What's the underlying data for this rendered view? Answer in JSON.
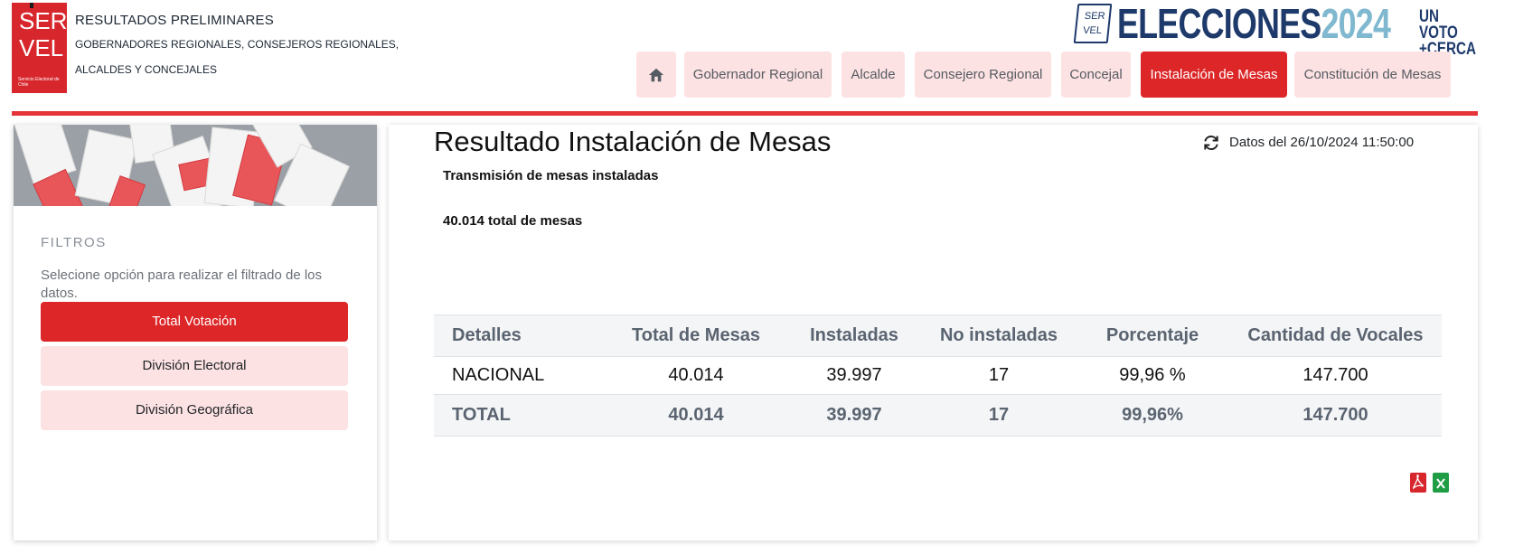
{
  "header": {
    "logo": {
      "line1": "SER",
      "line2": "VEL",
      "tagline": "Servicio Electoral de Chile"
    },
    "title": "RESULTADOS PRELIMINARES",
    "subtitle_line1": "GOBERNADORES REGIONALES, CONSEJEROS REGIONALES,",
    "subtitle_line2": "ALCALDES Y CONCEJALES",
    "brand": {
      "seal_line1": "SER",
      "seal_line2": "VEL",
      "word": "ELECCIONES",
      "year": "2024",
      "tag_line1": "UN VOTO",
      "tag_line2": "+CERCA"
    }
  },
  "nav": {
    "items": [
      {
        "label": "Gobernador Regional"
      },
      {
        "label": "Alcalde"
      },
      {
        "label": "Consejero Regional"
      },
      {
        "label": "Concejal"
      },
      {
        "label": "Instalación de Mesas"
      },
      {
        "label": "Constitución de Mesas"
      }
    ],
    "active_index": 4
  },
  "sidebar": {
    "filters_title": "FILTROS",
    "filters_desc": "Selecione opción para realizar el filtrado de los datos.",
    "buttons": [
      {
        "label": "Total Votación"
      },
      {
        "label": "División Electoral"
      },
      {
        "label": "División Geográfica"
      }
    ]
  },
  "main": {
    "title": "Resultado Instalación de Mesas",
    "updated": "Datos del 26/10/2024 11:50:00",
    "subtitle": "Transmisión de mesas instaladas",
    "total_text": "40.014 total de mesas",
    "table": {
      "headers": [
        "Detalles",
        "Total de Mesas",
        "Instaladas",
        "No instaladas",
        "Porcentaje",
        "Cantidad de Vocales"
      ],
      "rows": [
        [
          "NACIONAL",
          "40.014",
          "39.997",
          "17",
          "99,96 %",
          "147.700"
        ]
      ],
      "total": [
        "TOTAL",
        "40.014",
        "39.997",
        "17",
        "99,96%",
        "147.700"
      ]
    }
  },
  "colors": {
    "accent": "#dc2628",
    "nav_bg": "#fde2e3",
    "brand_blue": "#1e3a6b",
    "brand_light": "#7fb8cf"
  }
}
